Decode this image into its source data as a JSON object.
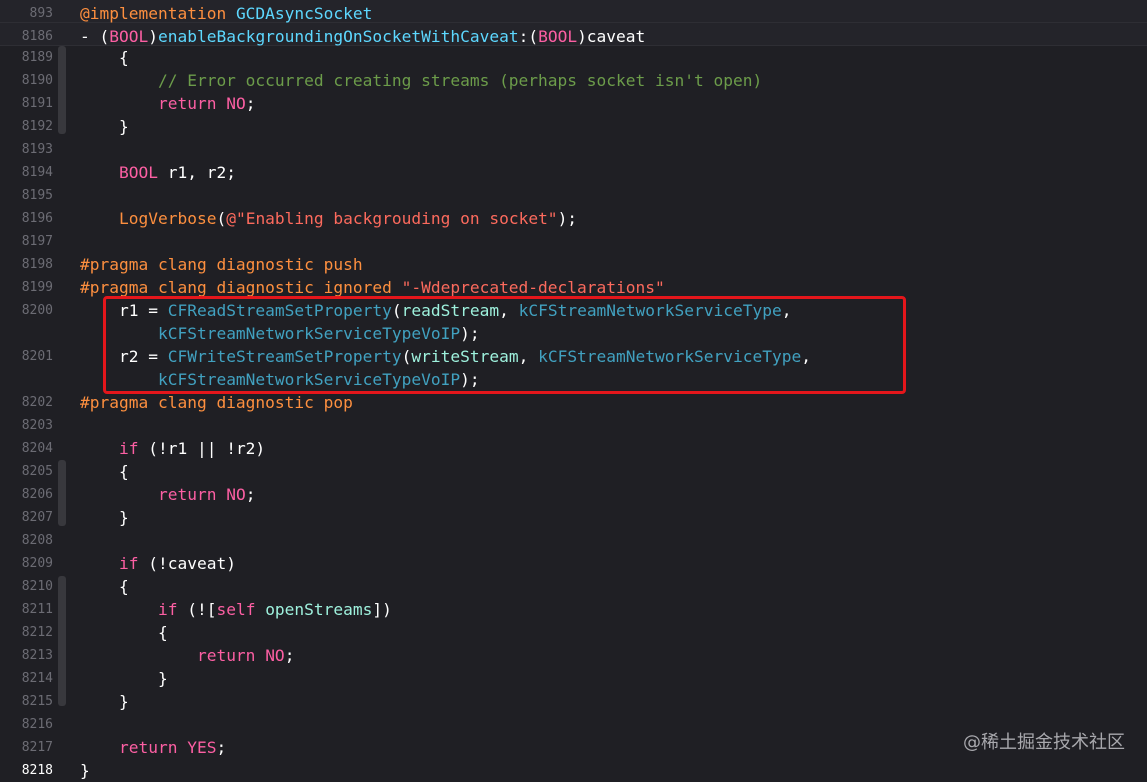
{
  "colors": {
    "background": "#1f1f24",
    "keyword": "#fc5fa3",
    "string": "#fc6a5d",
    "comment": "#6c9c4a",
    "preprocessor": "#fd8f3f",
    "api": "#41a1c0",
    "highlight_border": "#e4161b"
  },
  "sticky": [
    {
      "ln": "893",
      "tokens": [
        [
          "pp",
          "@implementation "
        ],
        [
          "decl",
          "GCDAsyncSocket"
        ]
      ]
    },
    {
      "ln": "8186",
      "tokens": [
        [
          "plain",
          "- ("
        ],
        [
          "kw",
          "BOOL"
        ],
        [
          "plain",
          ")"
        ],
        [
          "decl",
          "enableBackgroundingOnSocketWithCaveat"
        ],
        [
          "plain",
          ":("
        ],
        [
          "kw",
          "BOOL"
        ],
        [
          "plain",
          ")caveat"
        ]
      ]
    }
  ],
  "lines": [
    {
      "ln": "8189",
      "tokens": [
        [
          "plain",
          "    {"
        ]
      ]
    },
    {
      "ln": "8190",
      "tokens": [
        [
          "cmt",
          "        // Error occurred creating streams (perhaps socket isn't open)"
        ]
      ]
    },
    {
      "ln": "8191",
      "tokens": [
        [
          "plain",
          "        "
        ],
        [
          "kw",
          "return"
        ],
        [
          "plain",
          " "
        ],
        [
          "kw",
          "NO"
        ],
        [
          "plain",
          ";"
        ]
      ]
    },
    {
      "ln": "8192",
      "tokens": [
        [
          "plain",
          "    }"
        ]
      ]
    },
    {
      "ln": "8193",
      "tokens": []
    },
    {
      "ln": "8194",
      "tokens": [
        [
          "plain",
          "    "
        ],
        [
          "kw",
          "BOOL"
        ],
        [
          "plain",
          " r1, r2;"
        ]
      ]
    },
    {
      "ln": "8195",
      "tokens": []
    },
    {
      "ln": "8196",
      "tokens": [
        [
          "plain",
          "    "
        ],
        [
          "pp",
          "LogVerbose"
        ],
        [
          "plain",
          "("
        ],
        [
          "str",
          "@\"Enabling backgrouding on socket\""
        ],
        [
          "plain",
          ");"
        ]
      ]
    },
    {
      "ln": "8197",
      "tokens": []
    },
    {
      "ln": "8198",
      "tokens": [
        [
          "pp",
          "#pragma clang diagnostic push"
        ]
      ]
    },
    {
      "ln": "8199",
      "tokens": [
        [
          "pp",
          "#pragma clang diagnostic ignored "
        ],
        [
          "str",
          "\"-Wdeprecated-declarations\""
        ]
      ]
    },
    {
      "ln": "8200",
      "tokens": [
        [
          "plain",
          "    r1 = "
        ],
        [
          "api",
          "CFReadStreamSetProperty"
        ],
        [
          "plain",
          "("
        ],
        [
          "var",
          "readStream"
        ],
        [
          "plain",
          ", "
        ],
        [
          "api",
          "kCFStreamNetworkServiceType"
        ],
        [
          "plain",
          ","
        ]
      ]
    },
    {
      "ln": "",
      "tokens": [
        [
          "plain",
          "        "
        ],
        [
          "api",
          "kCFStreamNetworkServiceTypeVoIP"
        ],
        [
          "plain",
          ");"
        ]
      ]
    },
    {
      "ln": "8201",
      "tokens": [
        [
          "plain",
          "    r2 = "
        ],
        [
          "api",
          "CFWriteStreamSetProperty"
        ],
        [
          "plain",
          "("
        ],
        [
          "var",
          "writeStream"
        ],
        [
          "plain",
          ", "
        ],
        [
          "api",
          "kCFStreamNetworkServiceType"
        ],
        [
          "plain",
          ","
        ]
      ]
    },
    {
      "ln": "",
      "tokens": [
        [
          "plain",
          "        "
        ],
        [
          "api",
          "kCFStreamNetworkServiceTypeVoIP"
        ],
        [
          "plain",
          ");"
        ]
      ]
    },
    {
      "ln": "8202",
      "tokens": [
        [
          "pp",
          "#pragma clang diagnostic pop"
        ]
      ]
    },
    {
      "ln": "8203",
      "tokens": []
    },
    {
      "ln": "8204",
      "tokens": [
        [
          "plain",
          "    "
        ],
        [
          "kw",
          "if"
        ],
        [
          "plain",
          " (!r1 || !r2)"
        ]
      ]
    },
    {
      "ln": "8205",
      "tokens": [
        [
          "plain",
          "    {"
        ]
      ]
    },
    {
      "ln": "8206",
      "tokens": [
        [
          "plain",
          "        "
        ],
        [
          "kw",
          "return"
        ],
        [
          "plain",
          " "
        ],
        [
          "kw",
          "NO"
        ],
        [
          "plain",
          ";"
        ]
      ]
    },
    {
      "ln": "8207",
      "tokens": [
        [
          "plain",
          "    }"
        ]
      ]
    },
    {
      "ln": "8208",
      "tokens": []
    },
    {
      "ln": "8209",
      "tokens": [
        [
          "plain",
          "    "
        ],
        [
          "kw",
          "if"
        ],
        [
          "plain",
          " (!caveat)"
        ]
      ]
    },
    {
      "ln": "8210",
      "tokens": [
        [
          "plain",
          "    {"
        ]
      ]
    },
    {
      "ln": "8211",
      "tokens": [
        [
          "plain",
          "        "
        ],
        [
          "kw",
          "if"
        ],
        [
          "plain",
          " (!["
        ],
        [
          "kw",
          "self"
        ],
        [
          "plain",
          " "
        ],
        [
          "var",
          "openStreams"
        ],
        [
          "plain",
          "])"
        ]
      ]
    },
    {
      "ln": "8212",
      "tokens": [
        [
          "plain",
          "        {"
        ]
      ]
    },
    {
      "ln": "8213",
      "tokens": [
        [
          "plain",
          "            "
        ],
        [
          "kw",
          "return"
        ],
        [
          "plain",
          " "
        ],
        [
          "kw",
          "NO"
        ],
        [
          "plain",
          ";"
        ]
      ]
    },
    {
      "ln": "8214",
      "tokens": [
        [
          "plain",
          "        }"
        ]
      ]
    },
    {
      "ln": "8215",
      "tokens": [
        [
          "plain",
          "    }"
        ]
      ]
    },
    {
      "ln": "8216",
      "tokens": []
    },
    {
      "ln": "8217",
      "tokens": [
        [
          "plain",
          "    "
        ],
        [
          "kw",
          "return"
        ],
        [
          "plain",
          " "
        ],
        [
          "kw",
          "YES"
        ],
        [
          "plain",
          ";"
        ]
      ]
    },
    {
      "ln": "8218",
      "tokens": [
        [
          "plain",
          "}"
        ]
      ],
      "current": true
    }
  ],
  "watermark": "@稀土掘金技术社区"
}
